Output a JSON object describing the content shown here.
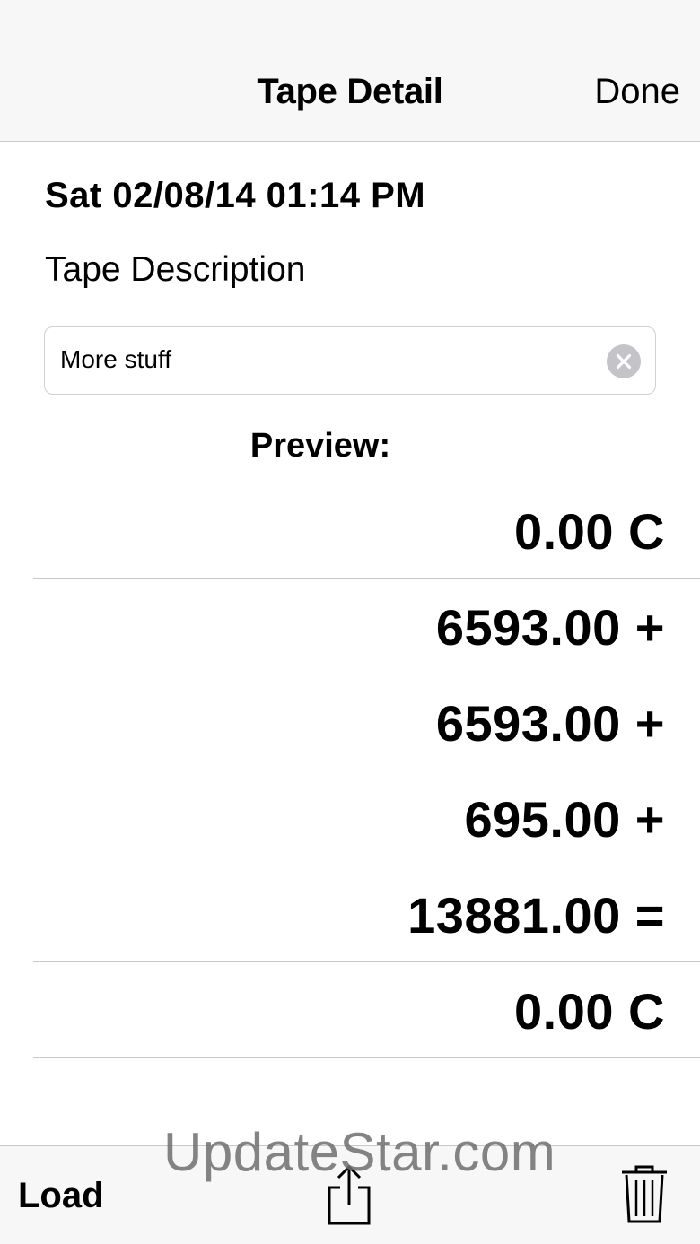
{
  "navbar": {
    "title": "Tape Detail",
    "done_label": "Done"
  },
  "tape": {
    "timestamp": "Sat 02/08/14 01:14 PM",
    "description_label": "Tape Description",
    "description_value": "More stuff",
    "preview_label": "Preview:",
    "entries": [
      "0.00 C",
      "6593.00 +",
      "6593.00 +",
      "695.00 +",
      "13881.00 =",
      "0.00 C"
    ]
  },
  "toolbar": {
    "load_label": "Load",
    "share_icon": "share-icon",
    "trash_icon": "trash-icon"
  },
  "watermark": "UpdateStar.com",
  "colors": {
    "bar_background": "#f7f7f7",
    "separator": "#c8c8cc",
    "clear_button": "#c4c4c8"
  }
}
